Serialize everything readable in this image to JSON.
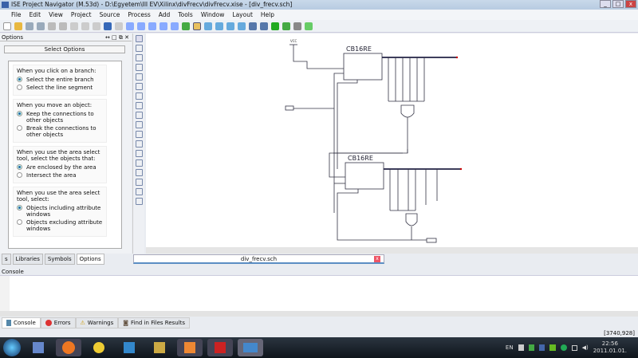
{
  "window": {
    "title": "ISE Project Navigator (M.53d) - D:\\Egyetem\\III EV\\Xilinx\\divFrecv\\divFrecv.xise - [div_frecv.sch]"
  },
  "menu": [
    "File",
    "Edit",
    "View",
    "Project",
    "Source",
    "Process",
    "Add",
    "Tools",
    "Window",
    "Layout",
    "Help"
  ],
  "options_panel": {
    "title": "Options",
    "select_options": "Select Options",
    "groups": [
      {
        "label": "When you click on a branch:",
        "options": [
          {
            "text": "Select the entire branch",
            "selected": true
          },
          {
            "text": "Select the line segment",
            "selected": false
          }
        ]
      },
      {
        "label": "When you move an object:",
        "options": [
          {
            "text": "Keep the connections to other objects",
            "selected": true
          },
          {
            "text": "Break the connections to other objects",
            "selected": false
          }
        ]
      },
      {
        "label": "When you use the area select tool, select the objects that:",
        "options": [
          {
            "text": "Are enclosed by the area",
            "selected": true
          },
          {
            "text": "Intersect the area",
            "selected": false
          }
        ]
      },
      {
        "label": "When you use the area select tool, select:",
        "options": [
          {
            "text": "Objects including attribute windows",
            "selected": true
          },
          {
            "text": "Objects excluding attribute windows",
            "selected": false
          }
        ]
      }
    ]
  },
  "left_tabs": [
    "s",
    "Libraries",
    "Symbols",
    "Options"
  ],
  "document_tab": "div_frecv.sch",
  "schematic": {
    "components": [
      "CB16RE",
      "CB16RE"
    ],
    "vcc": "VCC"
  },
  "console": {
    "title": "Console"
  },
  "bottom_tabs": [
    "Console",
    "Errors",
    "Warnings",
    "Find in Files Results"
  ],
  "status": {
    "coords": "[3740,928]"
  },
  "tray": {
    "lang": "EN",
    "time": "22:56",
    "date": "2011.01.01."
  }
}
